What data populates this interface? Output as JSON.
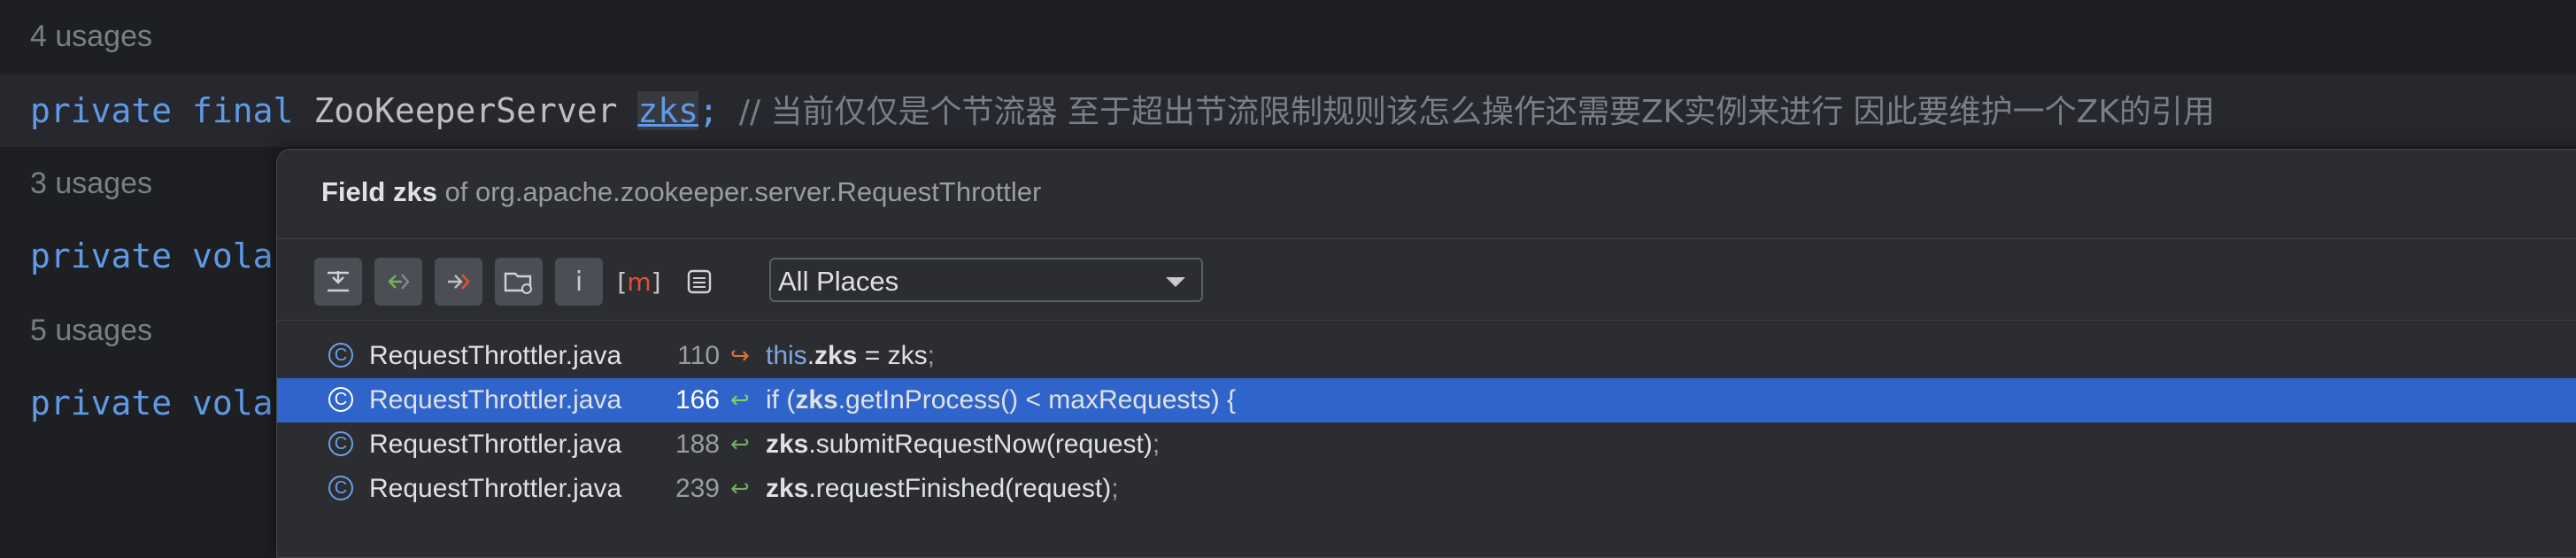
{
  "editor": {
    "usages": [
      "4 usages",
      "3 usages",
      "5 usages"
    ],
    "line1": {
      "kw1": "private",
      "kw2": "final",
      "type": "ZooKeeperServer",
      "field": "zks",
      "semi": ";",
      "comment": "// 当前仅仅是个节流器 至于超出节流限制规则该怎么操作还需要ZK实例来进行 因此要维护一个ZK的引用"
    },
    "line2": {
      "kw1": "private",
      "kw2": "vola"
    },
    "line3": {
      "kw1": "private",
      "kw2": "vola"
    }
  },
  "popup": {
    "title_field": "Field zks",
    "title_rest": " of org.apache.zookeeper.server.RequestThrottler",
    "toolbar_icons": [
      "merge-lines-icon",
      "read-access-icon",
      "write-access-icon",
      "folder-settings-icon",
      "info-icon",
      "method-icon",
      "preview-icon"
    ],
    "scope": "All Places",
    "results": [
      {
        "file": "RequestThrottler.java",
        "line": "110",
        "access": "write",
        "pre_this": "this",
        "pre": ".",
        "bold": "zks",
        "rest": " = zks",
        "end": ";"
      },
      {
        "file": "RequestThrottler.java",
        "line": "166",
        "access": "read",
        "pre_this": "",
        "pre": "if (",
        "bold": "zks",
        "rest": ".getInProcess() < maxRequests) {",
        "end": ""
      },
      {
        "file": "RequestThrottler.java",
        "line": "188",
        "access": "read",
        "pre_this": "",
        "pre": "",
        "bold": "zks",
        "rest": ".submitRequestNow(request)",
        "end": ";"
      },
      {
        "file": "RequestThrottler.java",
        "line": "239",
        "access": "read",
        "pre_this": "",
        "pre": "",
        "bold": "zks",
        "rest": ".requestFinished(request)",
        "end": ";"
      }
    ],
    "selected_index": 1
  },
  "colors": {
    "accent": "#2f65ca",
    "keyword": "#5f9ae6",
    "write": "#e0733a",
    "read": "#6fb15b"
  }
}
